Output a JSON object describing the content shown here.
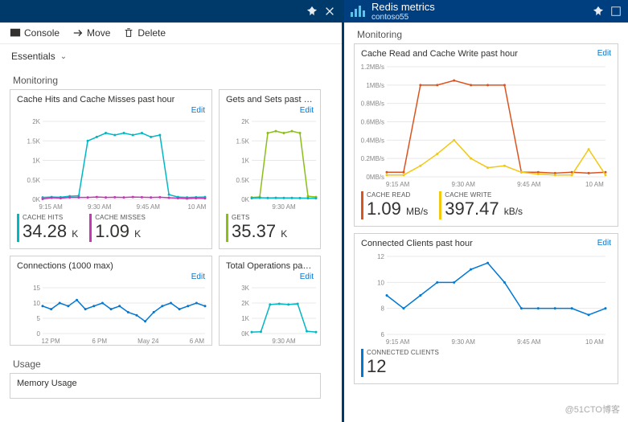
{
  "toolbar": {
    "console": "Console",
    "move": "Move",
    "delete": "Delete"
  },
  "essentials_label": "Essentials",
  "monitoring_label": "Monitoring",
  "usage_label": "Usage",
  "memory_usage_label": "Memory Usage",
  "edit_label": "Edit",
  "right_header": {
    "title": "Redis metrics",
    "subtitle": "contoso55"
  },
  "tiles": {
    "cache_hm": {
      "title": "Cache Hits and Cache Misses past hour",
      "metrics": [
        {
          "label": "CACHE HITS",
          "value": "34.28",
          "unit": "K"
        },
        {
          "label": "CACHE MISSES",
          "value": "1.09",
          "unit": "K"
        }
      ]
    },
    "gets_sets": {
      "title": "Gets and Sets past ho...",
      "metrics": [
        {
          "label": "GETS",
          "value": "35.37",
          "unit": "K"
        }
      ]
    },
    "connections": {
      "title": "Connections (1000 max)"
    },
    "total_ops": {
      "title": "Total Operations past..."
    },
    "cache_rw": {
      "title": "Cache Read and Cache Write past hour",
      "metrics": [
        {
          "label": "CACHE READ",
          "value": "1.09",
          "unit": "MB/s"
        },
        {
          "label": "CACHE WRITE",
          "value": "397.47",
          "unit": "kB/s"
        }
      ]
    },
    "connected_clients": {
      "title": "Connected Clients past hour",
      "metrics": [
        {
          "label": "CONNECTED CLIENTS",
          "value": "12",
          "unit": ""
        }
      ]
    }
  },
  "chart_data": [
    {
      "id": "cache_hm",
      "type": "line",
      "x_ticks": [
        "9:15 AM",
        "9:30 AM",
        "9:45 AM",
        "10 AM"
      ],
      "y_ticks": [
        "0K",
        "0.5K",
        "1K",
        "1.5K",
        "2K"
      ],
      "ylim": [
        0,
        2000
      ],
      "series": [
        {
          "name": "CACHE HITS",
          "color": "#00b7c3",
          "values": [
            50,
            60,
            55,
            80,
            90,
            1500,
            1600,
            1700,
            1650,
            1700,
            1650,
            1700,
            1600,
            1650,
            120,
            60,
            50,
            55,
            60
          ]
        },
        {
          "name": "CACHE MISSES",
          "color": "#c239b3",
          "values": [
            10,
            40,
            30,
            50,
            50,
            50,
            60,
            50,
            55,
            50,
            60,
            55,
            50,
            55,
            40,
            30,
            20,
            30,
            25
          ]
        }
      ]
    },
    {
      "id": "gets_sets",
      "type": "line",
      "x_ticks": [
        "9:30 AM"
      ],
      "y_ticks": [
        "0K",
        "0.5K",
        "1K",
        "1.5K",
        "2K"
      ],
      "ylim": [
        0,
        2000
      ],
      "series": [
        {
          "name": "GETS",
          "color": "#8cbd18",
          "values": [
            50,
            60,
            1700,
            1750,
            1700,
            1750,
            1700,
            80,
            60
          ]
        },
        {
          "name": "SETS",
          "color": "#00b7c3",
          "values": [
            30,
            40,
            35,
            38,
            36,
            35,
            34,
            30,
            28
          ]
        }
      ]
    },
    {
      "id": "connections",
      "type": "line",
      "x_ticks": [
        "12 PM",
        "6 PM",
        "May 24",
        "6 AM"
      ],
      "y_ticks": [
        "0",
        "5",
        "10",
        "15"
      ],
      "ylim": [
        0,
        15
      ],
      "series": [
        {
          "name": "Connections",
          "color": "#0078d4",
          "values": [
            9,
            8,
            10,
            9,
            11,
            8,
            9,
            10,
            8,
            9,
            7,
            6,
            4,
            7,
            9,
            10,
            8,
            9,
            10,
            9
          ]
        }
      ]
    },
    {
      "id": "total_ops",
      "type": "line",
      "x_ticks": [
        "9:30 AM"
      ],
      "y_ticks": [
        "0K",
        "1K",
        "2K",
        "3K"
      ],
      "ylim": [
        0,
        3000
      ],
      "series": [
        {
          "name": "Total Ops",
          "color": "#00b7c3",
          "values": [
            100,
            120,
            1900,
            1950,
            1900,
            1950,
            150,
            100
          ]
        }
      ]
    },
    {
      "id": "cache_rw",
      "type": "line",
      "x_ticks": [
        "9:15 AM",
        "9:30 AM",
        "9:45 AM",
        "10 AM"
      ],
      "y_ticks": [
        "0MB/s",
        "0.2MB/s",
        "0.4MB/s",
        "0.6MB/s",
        "0.8MB/s",
        "1MB/s",
        "1.2MB/s"
      ],
      "ylim": [
        0,
        1.2
      ],
      "series": [
        {
          "name": "CACHE READ",
          "color": "#d9541e",
          "values": [
            0.05,
            0.05,
            1.0,
            1.0,
            1.05,
            1.0,
            1.0,
            1.0,
            0.05,
            0.05,
            0.04,
            0.05,
            0.04,
            0.05
          ]
        },
        {
          "name": "CACHE WRITE",
          "color": "#f2c811",
          "values": [
            0.02,
            0.02,
            0.12,
            0.25,
            0.4,
            0.2,
            0.1,
            0.12,
            0.05,
            0.03,
            0.02,
            0.02,
            0.3,
            0.02
          ]
        }
      ]
    },
    {
      "id": "connected_clients",
      "type": "line",
      "x_ticks": [
        "9:15 AM",
        "9:30 AM",
        "9:45 AM",
        "10 AM"
      ],
      "y_ticks": [
        "6",
        "8",
        "10",
        "12"
      ],
      "ylim": [
        6,
        12
      ],
      "series": [
        {
          "name": "Connected",
          "color": "#0078d4",
          "values": [
            9,
            8,
            9,
            10,
            10,
            11,
            11.5,
            10,
            8,
            8,
            8,
            8,
            7.5,
            8
          ]
        }
      ]
    }
  ],
  "watermark": "@51CTO博客"
}
